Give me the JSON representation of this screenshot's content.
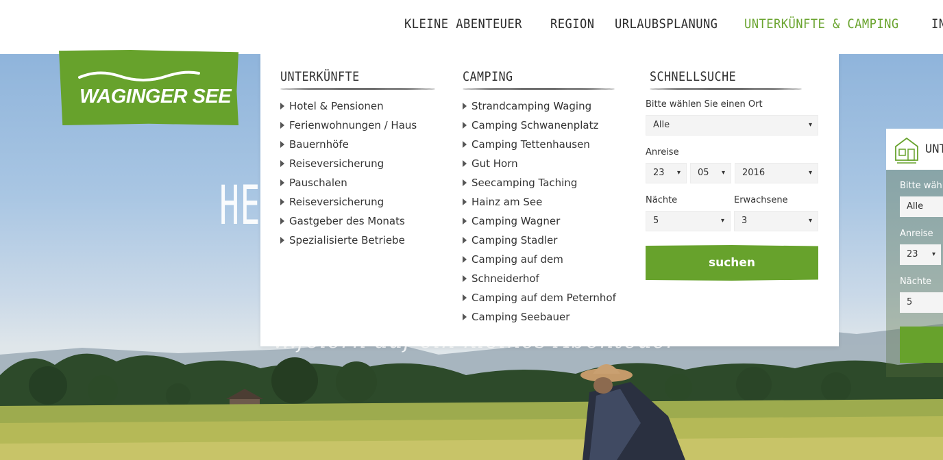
{
  "nav": {
    "items": [
      "KLEINE ABENTEUER",
      "REGION",
      "URLAUBSPLANUNG",
      "UNTERKÜNFTE & CAMPING",
      "INFO"
    ],
    "active_index": 3
  },
  "logo": {
    "text": "WAGINGER SEE",
    "brand_color": "#67a22c"
  },
  "hero": {
    "title": "HE",
    "subtitle": "...feiern auf ein kleines Abenteuer"
  },
  "menu": {
    "unterkuenfte": {
      "heading": "UNTERKÜNFTE",
      "items": [
        "Hotel & Pensionen",
        "Ferienwohnungen / Haus",
        "Bauernhöfe",
        "Reiseversicherung",
        "Pauschalen",
        "Reiseversicherung",
        "Gastgeber des Monats",
        "Spezialisierte Betriebe"
      ]
    },
    "camping": {
      "heading": "CAMPING",
      "items": [
        "Strandcamping Waging",
        "Camping Schwanenplatz",
        "Camping Tettenhausen",
        "Gut Horn",
        "Seecamping Taching",
        "Hainz am See",
        "Camping Wagner",
        "Camping Stadler",
        "Camping auf dem",
        "Schneiderhof",
        "Camping auf dem Peternhof",
        "Camping Seebauer"
      ]
    },
    "schnellsuche": {
      "heading": "SCHNELLSUCHE",
      "ort_label": "Bitte wählen Sie einen Ort",
      "ort_value": "Alle",
      "anreise_label": "Anreise",
      "day": "23",
      "month": "05",
      "year": "2016",
      "naechte_label": "Nächte",
      "naechte_value": "5",
      "erwachsene_label": "Erwachsene",
      "erwachsene_value": "3",
      "button": "suchen"
    }
  },
  "widget": {
    "title": "UNTE",
    "ort_label": "Bitte wählen",
    "ort_value": "Alle",
    "anreise_label": "Anreise",
    "day": "23",
    "naechte_label": "Nächte",
    "naechte_value": "5"
  },
  "caret": "▾"
}
